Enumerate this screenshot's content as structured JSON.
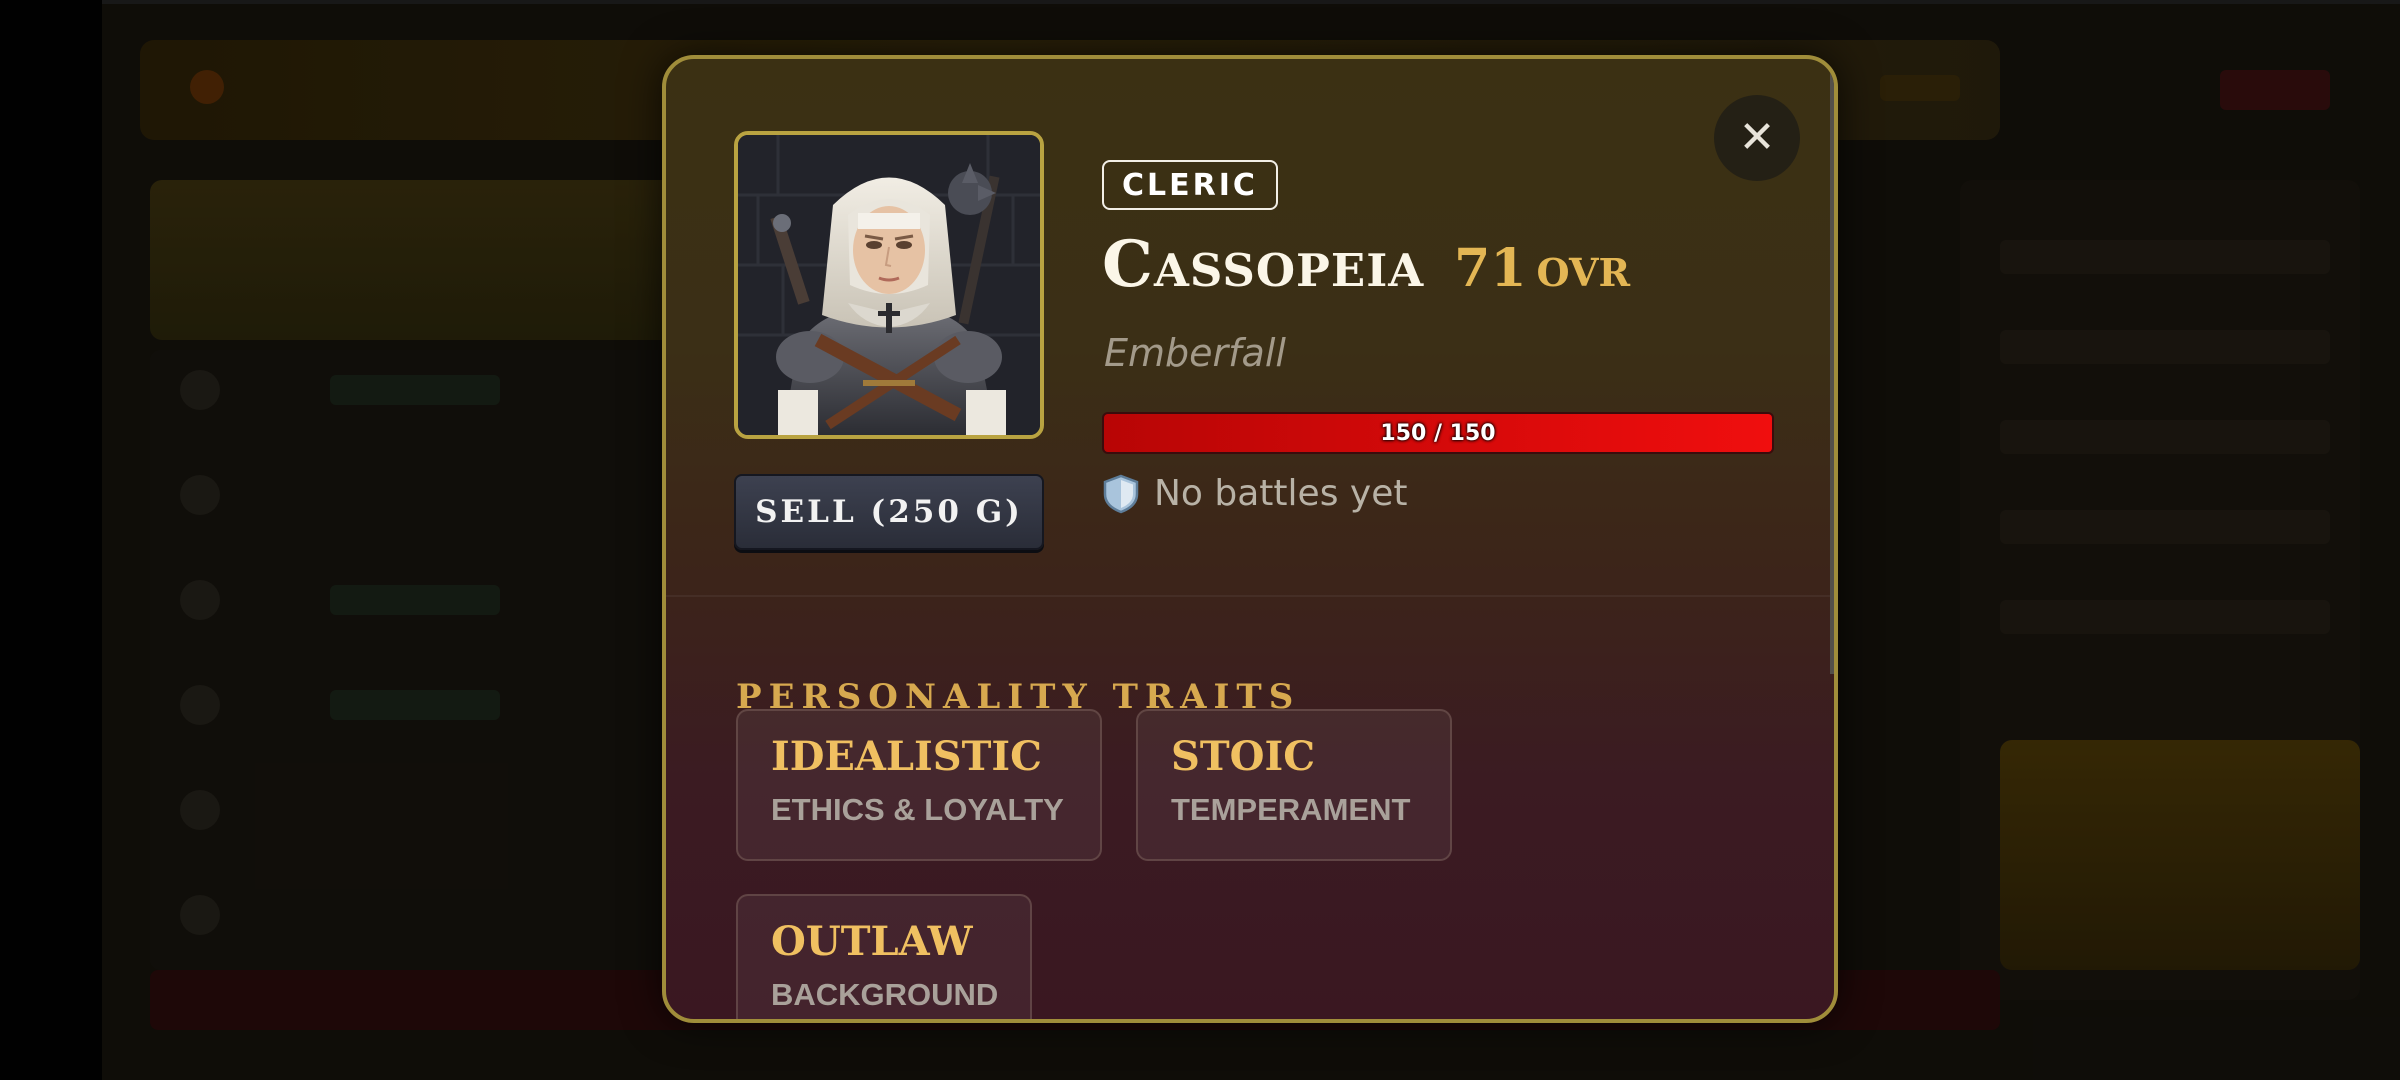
{
  "hero": {
    "class": "CLERIC",
    "name": "Cassopeia",
    "ovr_value": "71",
    "ovr_label": "OVR",
    "origin": "Emberfall",
    "hp": {
      "text": "150 / 150",
      "current": 150,
      "max": 150
    },
    "battles": {
      "icon": "shield-icon",
      "text": "No battles yet"
    },
    "portrait_icon": "cleric-portrait"
  },
  "actions": {
    "sell_label": "SELL (250 G)",
    "close_icon": "close-icon",
    "close_symbol": "✕"
  },
  "traits": {
    "title": "PERSONALITY TRAITS",
    "items": [
      {
        "name": "IDEALISTIC",
        "category": "ETHICS & LOYALTY"
      },
      {
        "name": "STOIC",
        "category": "TEMPERAMENT"
      },
      {
        "name": "OUTLAW",
        "category": "BACKGROUND"
      }
    ]
  },
  "colors": {
    "modal_border": "#a08d3a",
    "accent_gold": "#e3b654",
    "hp_red": "#f00e0e"
  }
}
